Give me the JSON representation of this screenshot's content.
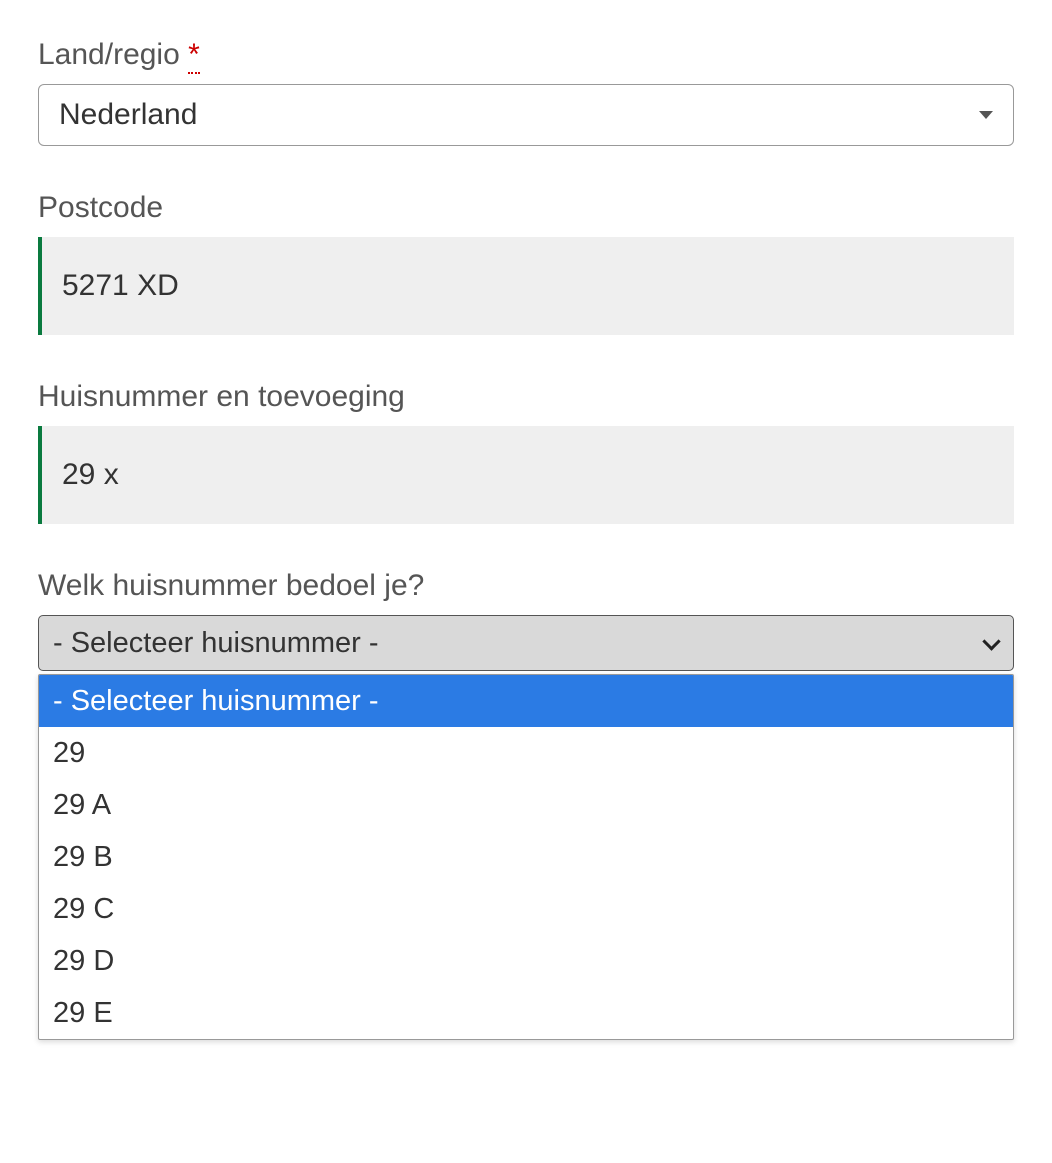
{
  "fields": {
    "country": {
      "label": "Land/regio",
      "required_mark": "*",
      "value": "Nederland"
    },
    "postcode": {
      "label": "Postcode",
      "value": "5271 XD"
    },
    "housenumber": {
      "label": "Huisnummer en toevoeging",
      "value": "29 x"
    },
    "which_number": {
      "label": "Welk huisnummer bedoel je?",
      "selected": "- Selecteer huisnummer -",
      "options": [
        "- Selecteer huisnummer -",
        "29",
        "29 A",
        "29 B",
        "29 C",
        "29 D",
        "29 E"
      ]
    }
  }
}
